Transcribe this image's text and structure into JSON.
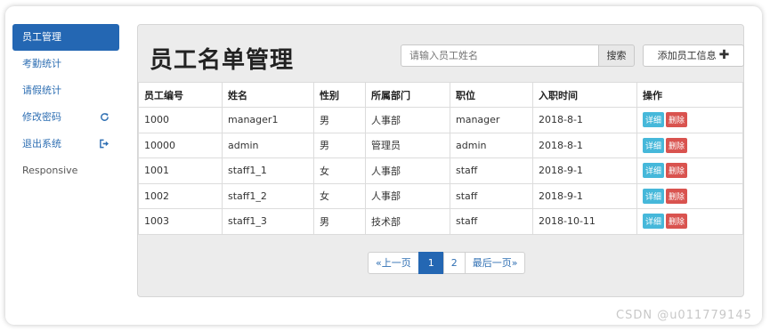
{
  "sidebar": {
    "items": [
      {
        "label": "员工管理",
        "icon": ""
      },
      {
        "label": "考勤统计",
        "icon": ""
      },
      {
        "label": "请假统计",
        "icon": ""
      },
      {
        "label": "修改密码",
        "icon": "refresh-icon"
      },
      {
        "label": "退出系统",
        "icon": "logout-icon"
      },
      {
        "label": "Responsive",
        "icon": ""
      }
    ]
  },
  "header": {
    "title": "员工名单管理",
    "search_placeholder": "请输入员工姓名",
    "search_label": "搜索",
    "add_label": "添加员工信息"
  },
  "table": {
    "columns": [
      "员工编号",
      "姓名",
      "性别",
      "所属部门",
      "职位",
      "入职时间",
      "操作"
    ],
    "rows": [
      [
        "1000",
        "manager1",
        "男",
        "人事部",
        "manager",
        "2018-8-1"
      ],
      [
        "10000",
        "admin",
        "男",
        "管理员",
        "admin",
        "2018-8-1"
      ],
      [
        "1001",
        "staff1_1",
        "女",
        "人事部",
        "staff",
        "2018-9-1"
      ],
      [
        "1002",
        "staff1_2",
        "女",
        "人事部",
        "staff",
        "2018-9-1"
      ],
      [
        "1003",
        "staff1_3",
        "男",
        "技术部",
        "staff",
        "2018-10-11"
      ]
    ],
    "detail_label": "详细",
    "delete_label": "删除"
  },
  "pagination": {
    "prev": "«上一页",
    "pages": [
      "1",
      "2"
    ],
    "current": "1",
    "last": "最后一页»"
  },
  "watermark": "CSDN @u011779145",
  "colors": {
    "accent": "#2467b3",
    "detail": "#46b8da",
    "delete": "#d9534f"
  }
}
